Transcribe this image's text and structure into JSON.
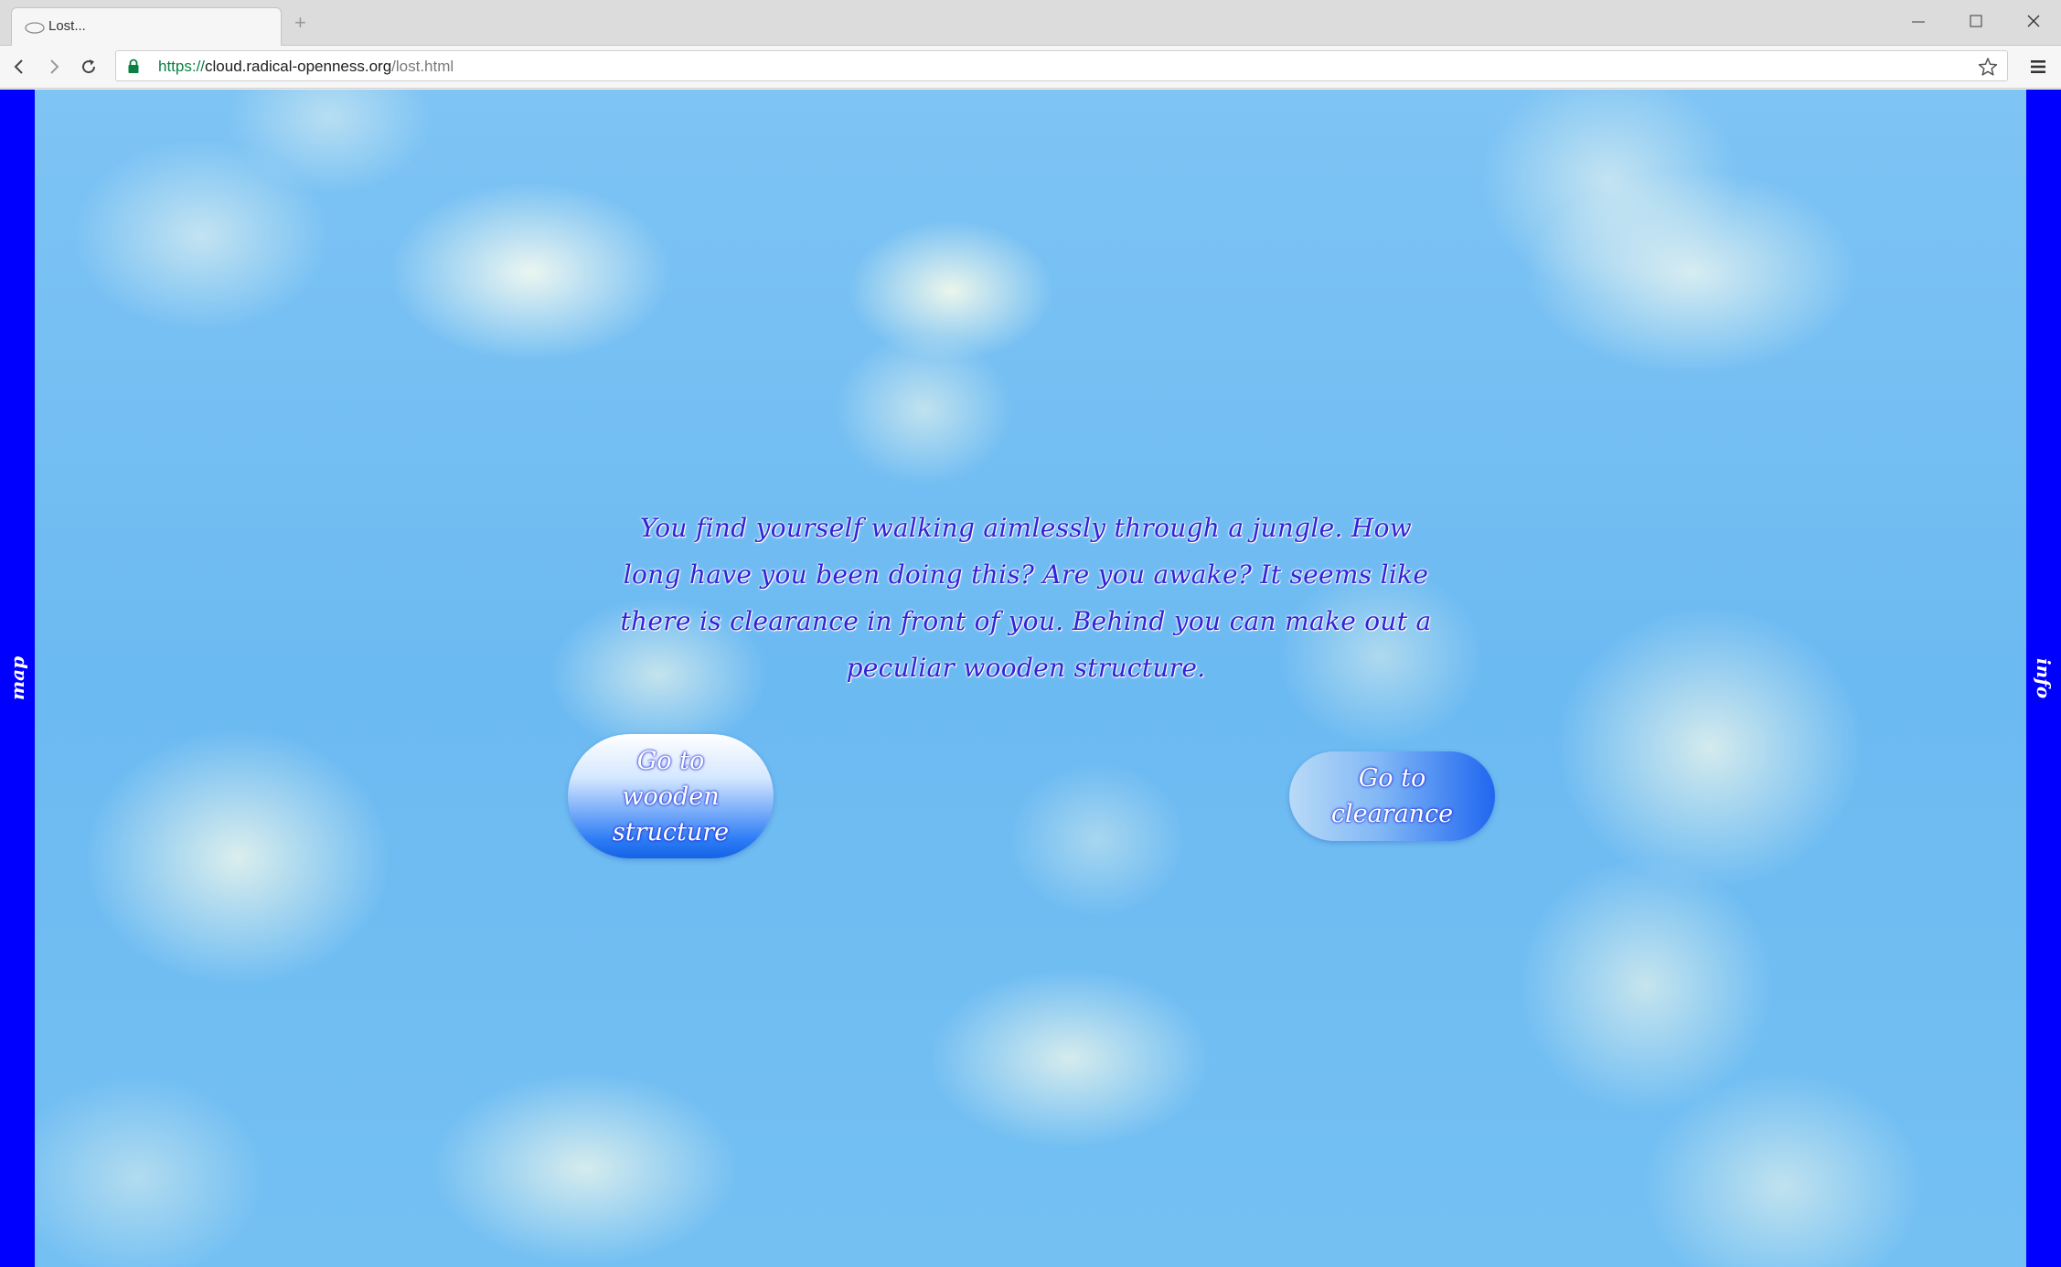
{
  "browser": {
    "tab_title": "Lost...",
    "new_tab_label": "+",
    "url_scheme": "https://",
    "url_host": "cloud.radical-openness.org",
    "url_path": "/lost.html",
    "icons": [
      "back-icon",
      "forward-icon",
      "reload-icon",
      "lock-icon",
      "star-icon",
      "menu-icon",
      "minimize-icon",
      "maximize-icon",
      "close-icon"
    ]
  },
  "page": {
    "side_left_label": "map",
    "side_right_label": "info",
    "story_text": "You find yourself walking aimlessly through a jungle. How long have you been doing this? Are you awake? It seems like there is clearance in front of you. Behind you can make out a peculiar wooden structure.",
    "choice_a_label": "Go to wooden structure",
    "choice_b_label": "Go to clearance",
    "colors": {
      "sidebar": "#0000ff",
      "story_text": "#3322d6",
      "sky": "#6cbaf4"
    }
  }
}
